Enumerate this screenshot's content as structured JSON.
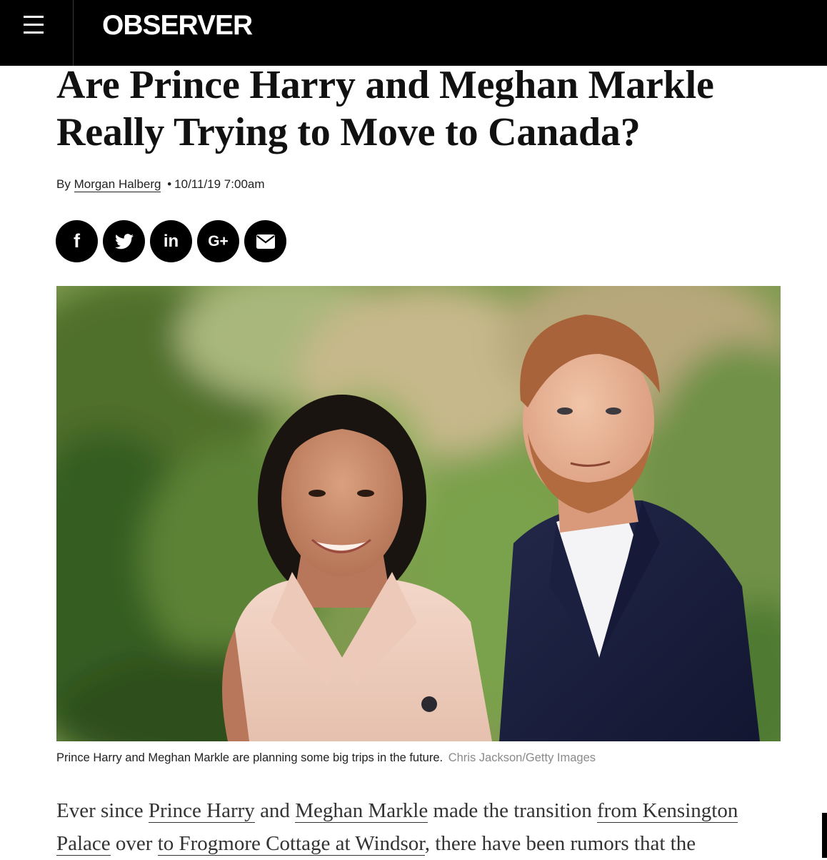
{
  "header": {
    "logo": "OBSERVER",
    "menu_icon": "hamburger-menu-icon",
    "background": "#000000"
  },
  "article": {
    "headline": "Are Prince Harry and Meghan Markle Really Trying to Move to Canada?",
    "byline": {
      "prefix": "By",
      "author": "Morgan Halberg",
      "separator": "•",
      "timestamp": "10/11/19 7:00am"
    },
    "share_buttons": [
      {
        "network": "Facebook",
        "glyph": "f",
        "icon": "facebook-icon"
      },
      {
        "network": "Twitter",
        "glyph": "",
        "icon": "twitter-icon"
      },
      {
        "network": "LinkedIn",
        "glyph": "in",
        "icon": "linkedin-icon"
      },
      {
        "network": "Google Plus",
        "glyph": "G+",
        "icon": "google-plus-icon"
      },
      {
        "network": "Email",
        "glyph": "",
        "icon": "envelope-icon"
      }
    ],
    "image": {
      "caption": "Prince Harry and Meghan Markle are planning some big trips in the future.",
      "credit": "Chris Jackson/Getty Images"
    },
    "body": {
      "t1": "Ever since ",
      "l1": "Prince Harry",
      "t2": " and ",
      "l2": "Meghan Markle",
      "t3": " made the transition ",
      "l3": "from Kensington Palace",
      "t4": " over ",
      "l4": "to Frogmore Cottage at Windsor",
      "t5": ", there have been rumors that the"
    }
  }
}
